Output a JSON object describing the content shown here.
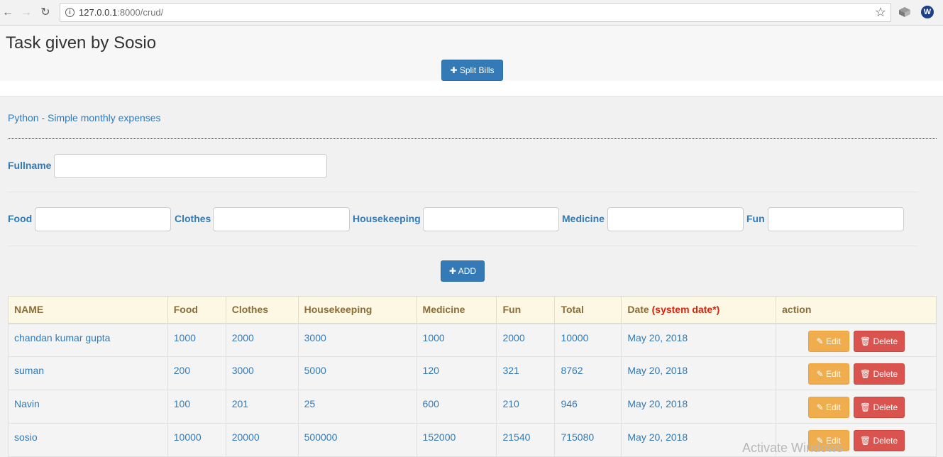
{
  "browser": {
    "url_host": "127.0.0.1",
    "url_rest": ":8000/crud/"
  },
  "header": {
    "title": "Task given by Sosio",
    "split_button": "Split Bills"
  },
  "form": {
    "subtitle": "Python - Simple monthly expenses",
    "fullname_label": "Fullname",
    "food_label": "Food",
    "clothes_label": "Clothes",
    "housekeeping_label": "Housekeeping",
    "medicine_label": "Medicine",
    "fun_label": "Fun",
    "add_button": "ADD"
  },
  "table": {
    "headers": {
      "name": "NAME",
      "food": "Food",
      "clothes": "Clothes",
      "housekeeping": "Housekeeping",
      "medicine": "Medicine",
      "fun": "Fun",
      "total": "Total",
      "date": "Date",
      "date_hint": "(system date*)",
      "action": "action"
    },
    "edit_label": "Edit",
    "delete_label": "Delete",
    "rows": [
      {
        "name": "chandan kumar gupta",
        "food": "1000",
        "clothes": "2000",
        "housekeeping": "3000",
        "medicine": "1000",
        "fun": "2000",
        "total": "10000",
        "date": "May 20, 2018"
      },
      {
        "name": "suman",
        "food": "200",
        "clothes": "3000",
        "housekeeping": "5000",
        "medicine": "120",
        "fun": "321",
        "total": "8762",
        "date": "May 20, 2018"
      },
      {
        "name": "Navin",
        "food": "100",
        "clothes": "201",
        "housekeeping": "25",
        "medicine": "600",
        "fun": "210",
        "total": "946",
        "date": "May 20, 2018"
      },
      {
        "name": "sosio",
        "food": "10000",
        "clothes": "20000",
        "housekeeping": "500000",
        "medicine": "152000",
        "fun": "21540",
        "total": "715080",
        "date": "May 20, 2018"
      }
    ]
  },
  "watermark": "Activate Windows"
}
